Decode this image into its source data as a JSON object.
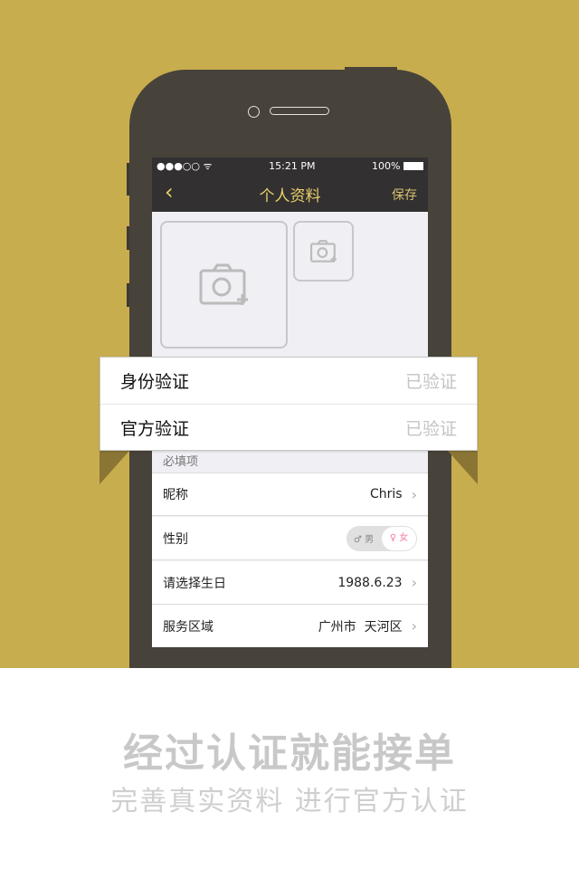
{
  "status": {
    "time": "15:21 PM",
    "battery": "100%"
  },
  "nav": {
    "back": "‹",
    "title": "个人资料",
    "save": "保存"
  },
  "verify": [
    {
      "label": "身份验证",
      "value": "已验证"
    },
    {
      "label": "官方验证",
      "value": "已验证"
    }
  ],
  "section": "必填项",
  "rows": {
    "nickname": {
      "label": "昵称",
      "value": "Chris"
    },
    "gender": {
      "label": "性别",
      "male": "♂ 男",
      "female": "♀ 女",
      "selected": "女"
    },
    "birthday": {
      "label": "请选择生日",
      "value": "1988.6.23"
    },
    "region": {
      "label": "服务区域",
      "value": "广州市  天河区"
    }
  },
  "promo": {
    "headline": "经过认证就能接单",
    "subline": "完善真实资料 进行官方认证"
  },
  "colors": {
    "background": "#c8ad4e",
    "phone": "#47423a",
    "accent": "#e9cf6c"
  }
}
